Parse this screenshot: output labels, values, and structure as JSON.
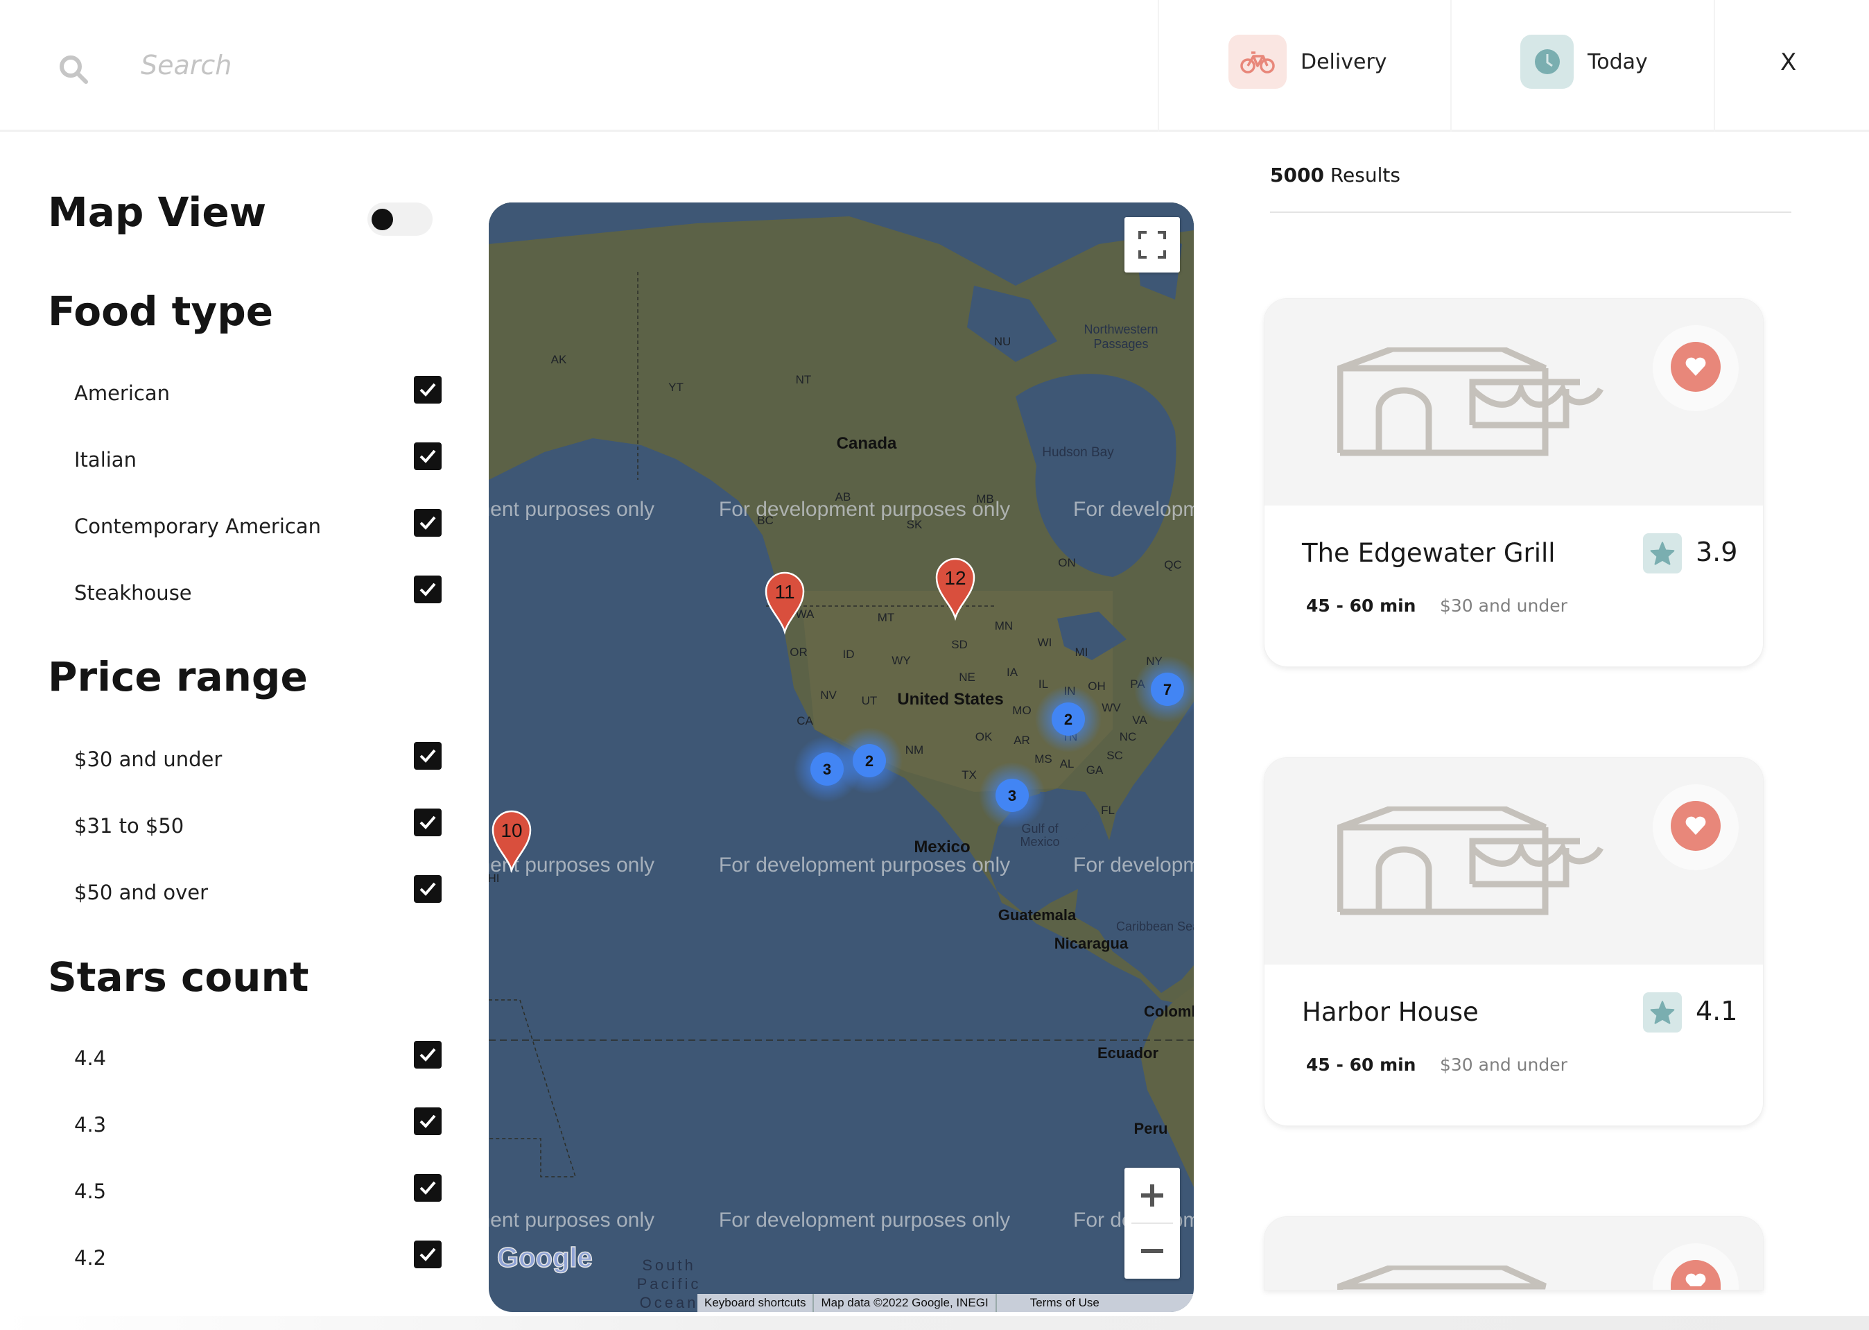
{
  "header": {
    "search_placeholder": "Search",
    "delivery_label": "Delivery",
    "today_label": "Today",
    "close_label": "X"
  },
  "filters": {
    "map_view": {
      "label": "Map View",
      "enabled": false
    },
    "food_type": {
      "title": "Food type",
      "options": [
        {
          "label": "American",
          "checked": true
        },
        {
          "label": "Italian",
          "checked": true
        },
        {
          "label": "Contemporary American",
          "checked": true
        },
        {
          "label": "Steakhouse",
          "checked": true
        }
      ]
    },
    "price_range": {
      "title": "Price range",
      "options": [
        {
          "label": "$30 and under",
          "checked": true
        },
        {
          "label": "$31 to $50",
          "checked": true
        },
        {
          "label": "$50 and over",
          "checked": true
        }
      ]
    },
    "stars_count": {
      "title": "Stars count",
      "options": [
        {
          "label": "4.4",
          "checked": true
        },
        {
          "label": "4.3",
          "checked": true
        },
        {
          "label": "4.5",
          "checked": true
        },
        {
          "label": "4.2",
          "checked": true
        }
      ]
    }
  },
  "map": {
    "watermark": "For development purposes only",
    "labels": {
      "canada": "Canada",
      "united_states": "United States",
      "mexico": "Mexico",
      "guatemala": "Guatemala",
      "nicaragua": "Nicaragua",
      "colombia": "Colombia",
      "ecuador": "Ecuador",
      "peru": "Peru",
      "hudson_bay": "Hudson Bay",
      "northwestern": "Northwestern",
      "passages": "Passages",
      "gulf_of": "Gulf of",
      "gulf_mexico": "Mexico",
      "caribbean": "Caribbean Sea",
      "south": "South",
      "pacific": "Pacific",
      "ocean": "Ocean"
    },
    "states": [
      "AK",
      "YT",
      "NT",
      "NU",
      "BC",
      "AB",
      "SK",
      "MB",
      "ON",
      "QC",
      "WA",
      "MT",
      "OR",
      "ID",
      "WY",
      "SD",
      "NE",
      "IA",
      "MN",
      "WI",
      "MI",
      "NV",
      "UT",
      "CA",
      "NM",
      "OK",
      "AR",
      "MO",
      "TX",
      "MS",
      "AL",
      "GA",
      "TN",
      "IL",
      "IN",
      "OH",
      "PA",
      "NY",
      "WV",
      "VA",
      "NC",
      "SC",
      "FL",
      "HI"
    ],
    "markers": [
      {
        "label": "11"
      },
      {
        "label": "12"
      },
      {
        "label": "10"
      }
    ],
    "clusters": [
      {
        "count": "3"
      },
      {
        "count": "2"
      },
      {
        "count": "3"
      },
      {
        "count": "2"
      },
      {
        "count": "7"
      }
    ],
    "logo": "Google",
    "attribution": {
      "keyboard": "Keyboard shortcuts",
      "data": "Map data ©2022 Google, INEGI",
      "terms": "Terms of Use"
    }
  },
  "results": {
    "count": "5000",
    "count_suffix": "Results",
    "cards": [
      {
        "name": "The Edgewater Grill",
        "rating": "3.9",
        "time": "45 - 60 min",
        "price": "$30 and under"
      },
      {
        "name": "Harbor House",
        "rating": "4.1",
        "time": "45 - 60 min",
        "price": "$30 and under"
      },
      {}
    ]
  },
  "colors": {
    "accent_red": "#e8877a",
    "accent_teal": "#7aaeb0",
    "marker_red": "#d94f3d",
    "cluster_blue": "#4285f4"
  }
}
